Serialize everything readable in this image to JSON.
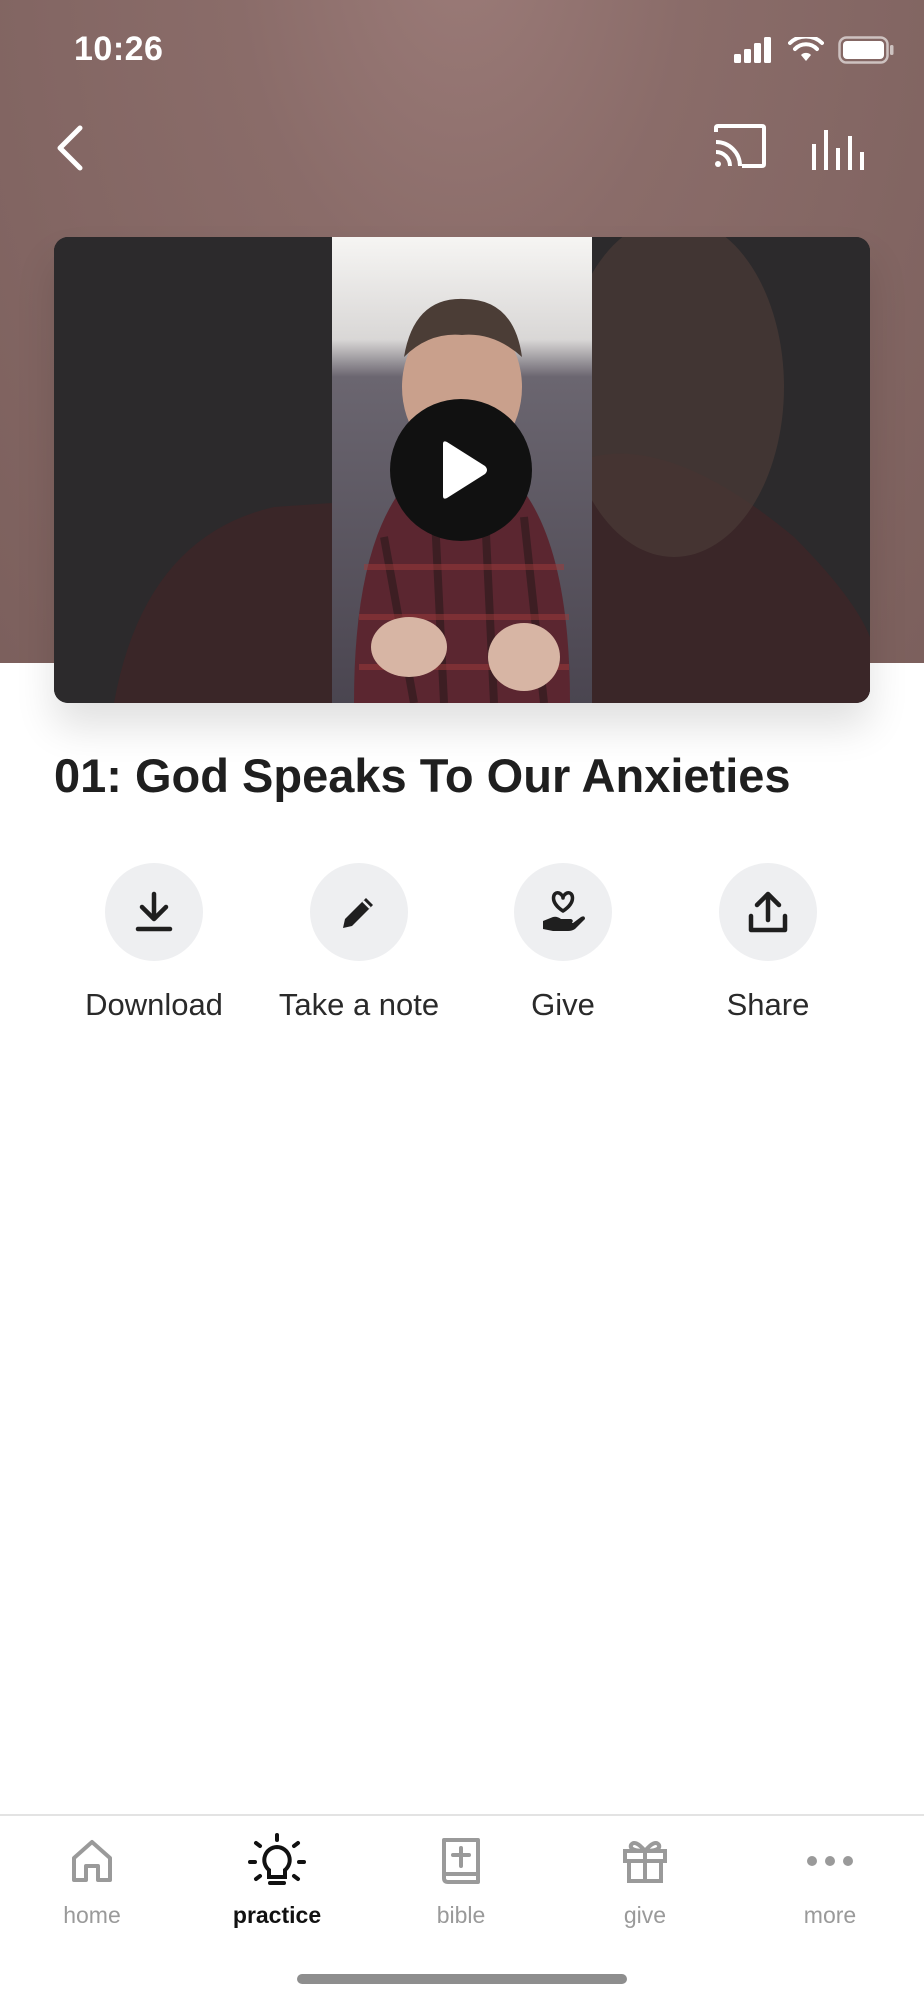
{
  "status_bar": {
    "time": "10:26"
  },
  "colors": {
    "hero": "#8a6c69",
    "icon_bg": "#eeeff1",
    "tab_inactive": "#9a9a9a",
    "tab_active": "#111111"
  },
  "video": {
    "title": "01: God Speaks To Our Anxieties"
  },
  "actions": [
    {
      "label": "Download",
      "icon": "download-icon"
    },
    {
      "label": "Take a note",
      "icon": "pencil-icon"
    },
    {
      "label": "Give",
      "icon": "hand-heart-icon"
    },
    {
      "label": "Share",
      "icon": "share-icon"
    }
  ],
  "tabbar": {
    "items": [
      {
        "label": "home",
        "icon": "home-icon",
        "active": false
      },
      {
        "label": "practice",
        "icon": "lightbulb-icon",
        "active": true
      },
      {
        "label": "bible",
        "icon": "bible-icon",
        "active": false
      },
      {
        "label": "give",
        "icon": "gift-icon",
        "active": false
      },
      {
        "label": "more",
        "icon": "more-icon",
        "active": false
      }
    ]
  }
}
